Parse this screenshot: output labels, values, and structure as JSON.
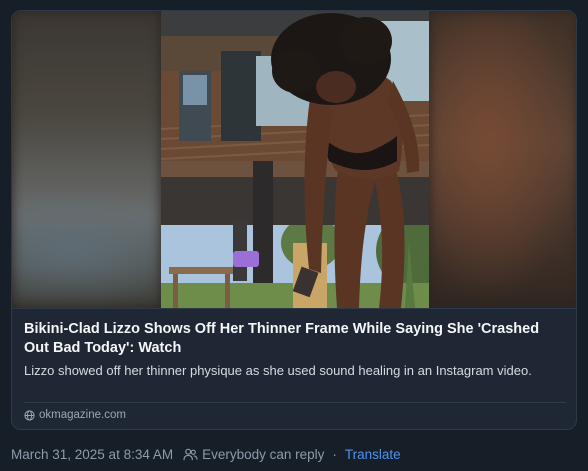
{
  "link_card": {
    "headline": "Bikini-Clad Lizzo Shows Off Her Thinner Frame While Saying She 'Crashed Out Bad Today': Watch",
    "description": "Lizzo showed off her thinner physique as she used sound healing in an Instagram video.",
    "source_domain": "okmagazine.com",
    "source_icon": "globe-icon"
  },
  "post_meta": {
    "timestamp": "March 31, 2025 at 8:34 AM",
    "reply_icon": "people-icon",
    "reply_setting": "Everybody can reply",
    "separator": "·",
    "translate_label": "Translate"
  },
  "colors": {
    "background": "#161e27",
    "card_border": "#2e3a48",
    "link_blue": "#4e93f0",
    "muted_text": "#8e9bab"
  }
}
